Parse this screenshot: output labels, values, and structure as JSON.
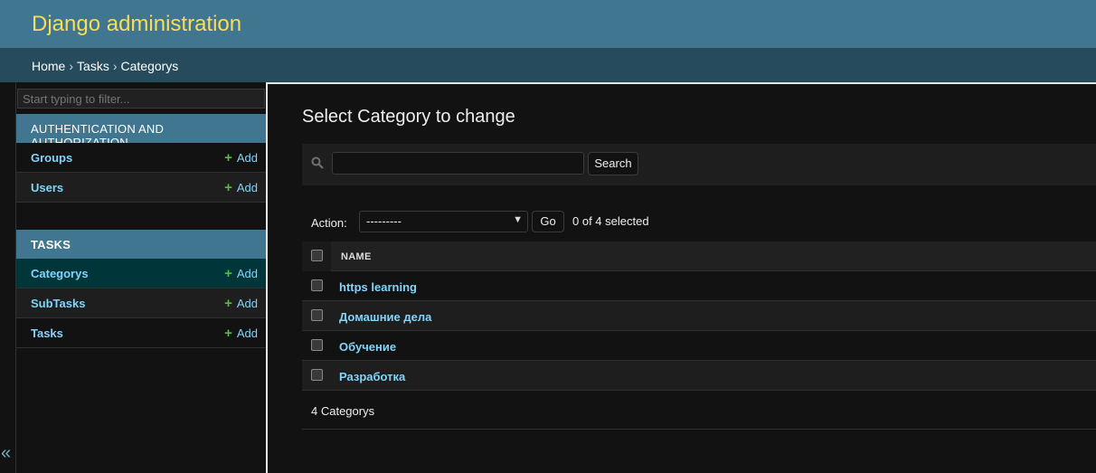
{
  "header": {
    "branding": "Django administration"
  },
  "breadcrumbs": {
    "home": "Home",
    "sep": "›",
    "app": "Tasks",
    "current": "Categorys"
  },
  "nav": {
    "filter_placeholder": "Start typing to filter...",
    "modules": [
      {
        "caption": "AUTHENTICATION AND AUTHORIZATION",
        "items": [
          {
            "label": "Groups",
            "add": "Add"
          },
          {
            "label": "Users",
            "add": "Add"
          }
        ]
      },
      {
        "caption": "TASKS",
        "items": [
          {
            "label": "Categorys",
            "add": "Add",
            "current": true
          },
          {
            "label": "SubTasks",
            "add": "Add"
          },
          {
            "label": "Tasks",
            "add": "Add"
          }
        ]
      }
    ],
    "toggle_glyph": "«"
  },
  "content": {
    "title": "Select Category to change",
    "search_button": "Search",
    "action_label": "Action:",
    "action_selected": "---------",
    "go_button": "Go",
    "selected_count": "0 of 4 selected",
    "column_header": "NAME",
    "rows": [
      "https learning",
      "Домашние дела",
      "Обучение",
      "Разработка"
    ],
    "paginator": "4 Categorys"
  },
  "colors": {
    "header_bg": "#417690",
    "branding": "#f5dd5d",
    "breadcrumbs_bg": "#264b5d",
    "link": "#81d4fa",
    "add_plus": "#5bb749",
    "current_row": "#00363a"
  },
  "icons": {
    "search": "search-icon",
    "add": "plus-icon",
    "collapse": "double-chevron-left-icon"
  }
}
